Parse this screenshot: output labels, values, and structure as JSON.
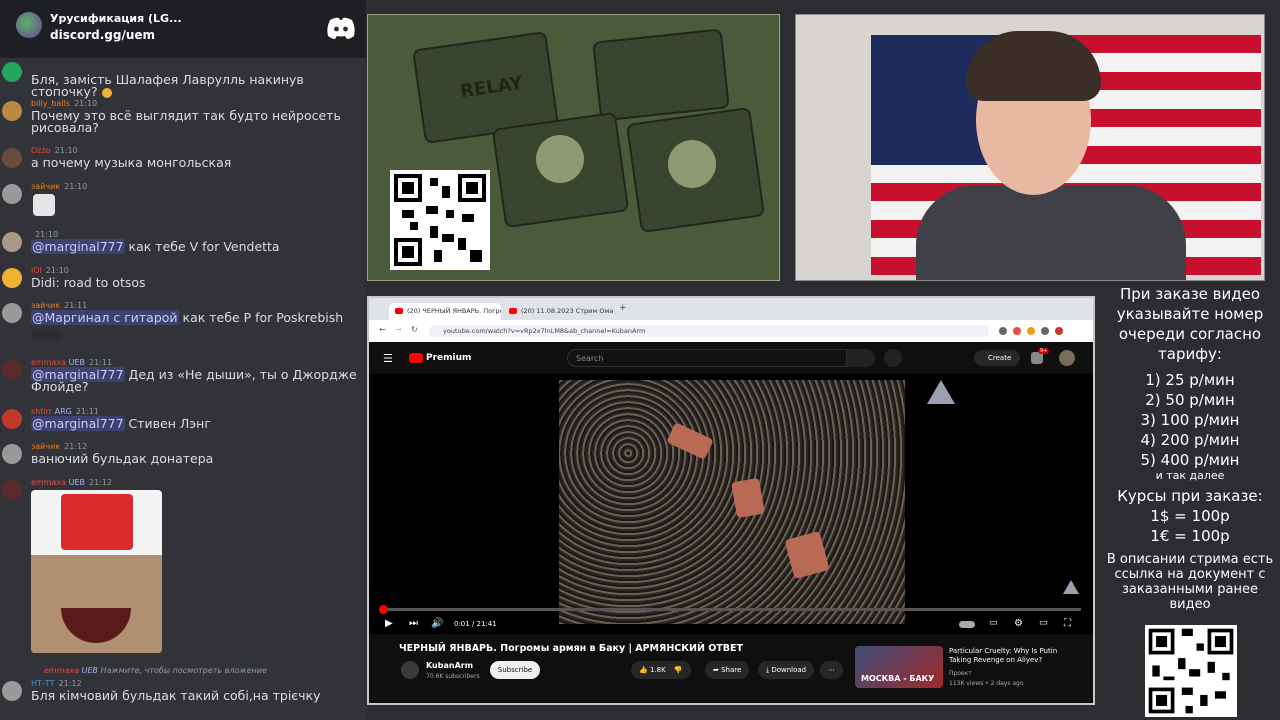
{
  "chat": {
    "server_name": "Урусификация (LG...",
    "server_link": "discord.gg/uem",
    "messages": [
      {
        "user": "",
        "time": "",
        "text": "Бля, замість Шалафея Лаврулль накинув стопочку?"
      },
      {
        "user": "billy_balls",
        "time": "21:10",
        "text": "Почему это всё выглядит так будто нейросеть рисовала?"
      },
      {
        "user": "Ozzo",
        "time": "21:10",
        "text": "а почему музыка монгольская"
      },
      {
        "user": "зайчик",
        "time": "21:10",
        "text": ""
      },
      {
        "user": "",
        "time": "21:10",
        "mention": "@marginal777",
        "text": " как тебе V for Vendetta"
      },
      {
        "user": "lOl",
        "time": "21:10",
        "text": "Didi: road to otsos"
      },
      {
        "user": "зайчик",
        "time": "21:11",
        "mention": "@Маргинал с гитарой",
        "text": " как тебе Р for Poskrebish"
      },
      {
        "user": "emmaxa",
        "badge": "UEB",
        "time": "21:11",
        "mention": "@marginal777",
        "text": " Дед из «Не дыши», ты о Джордже Флойде?"
      },
      {
        "user": "shtirr",
        "badge": "ARG",
        "time": "21:11",
        "mention": "@marginal777",
        "text": " Стивен Лэнг"
      },
      {
        "user": "зайчик",
        "time": "21:12",
        "text": "ванючий бульдак донатера"
      },
      {
        "user": "emmaxa",
        "badge": "UEB",
        "time": "21:12",
        "text": ""
      },
      {
        "user": "emmaxa",
        "badge": "UEB",
        "time": "",
        "text": "Нажмите, чтобы посмотреть вложение"
      },
      {
        "user": "НТ-ТТ",
        "time": "21:12",
        "text": "Бля кімчовий бульдак такий собі,на трієчку"
      }
    ]
  },
  "relay": {
    "label": "RELAY"
  },
  "browser": {
    "tab1": "(20) ЧЕРНЫЙ ЯНВАРЬ. Погромы",
    "tab2": "(20) 11.08.2023 Стрим Ома",
    "url": "youtube.com/watch?v=vRp2x7lnLM8&ab_channel=KubanArm",
    "brand": "Premium",
    "search_placeholder": "Search",
    "create_label": "Create",
    "notif_count": "9+",
    "time_display": "0:01 / 21:41",
    "progress": 0.001,
    "video_title": "ЧЕРНЫЙ ЯНВАРЬ. Погромы армян в Баку | АРМЯНСКИЙ ОТВЕТ",
    "channel_name": "KubanArm",
    "channel_subs": "70.6K subscribers",
    "subscribe_label": "Subscribe",
    "likes": "1.8K",
    "share_label": "Share",
    "download_label": "Download",
    "rec": {
      "thumb_text": "МОСКВА - БАКУ",
      "title": "Particular Cruelty: Why Is Putin Taking Revenge on Aliyev?",
      "channel": "Проект",
      "meta": "113K views • 2 days ago"
    }
  },
  "info": {
    "line1": "При заказе видео указывайте номер очереди согласно тарифу:",
    "tariffs": [
      "1) 25 р/мин",
      "2) 50 р/мин",
      "3) 100 р/мин",
      "4) 200 р/мин",
      "5) 400 р/мин"
    ],
    "etc": "и так далее",
    "rates_title": "Курсы при заказе:",
    "rates": [
      "1$ = 100р",
      "1€ = 100р"
    ],
    "footer": "В описании стрима есть ссылка на документ с заказанными ранее видео"
  }
}
